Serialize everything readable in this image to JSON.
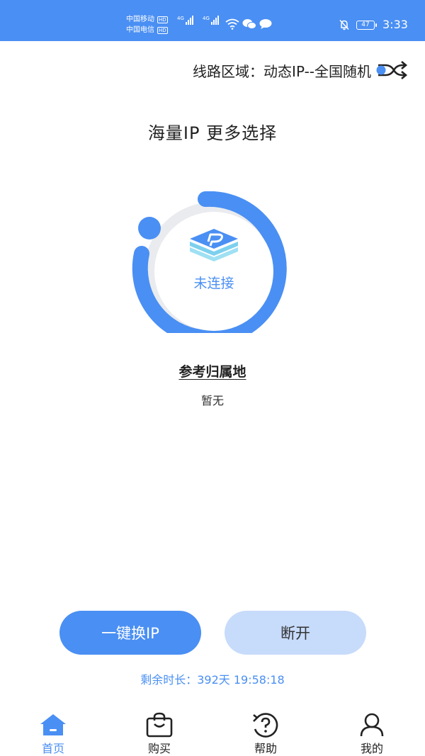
{
  "status_bar": {
    "carrier_1": "中国移动",
    "carrier_2": "中国电信",
    "hd_badge": "HD",
    "network_type": "4G",
    "battery_level": "47",
    "time": "3:33"
  },
  "route": {
    "label": "线路区域：动态IP--全国随机",
    "icon": "shuffle-icon"
  },
  "slogan": "海量IP 更多选择",
  "connection": {
    "status": "未连接",
    "icon": "ip-layers-logo-icon"
  },
  "region": {
    "title": "参考归属地",
    "value": "暂无"
  },
  "actions": {
    "change_ip_label": "一键换IP",
    "disconnect_label": "断开"
  },
  "remaining_time": "剩余时长：392天 19:58:18",
  "bottom_nav": {
    "items": [
      {
        "label": "首页",
        "icon": "home-icon",
        "active": true
      },
      {
        "label": "购买",
        "icon": "shopping-bag-icon",
        "active": false
      },
      {
        "label": "帮助",
        "icon": "help-icon",
        "active": false
      },
      {
        "label": "我的",
        "icon": "user-icon",
        "active": false
      }
    ]
  },
  "colors": {
    "accent": "#4a8ff3",
    "accent_light": "#c7dbfb",
    "ring_track": "#e9ebef"
  }
}
